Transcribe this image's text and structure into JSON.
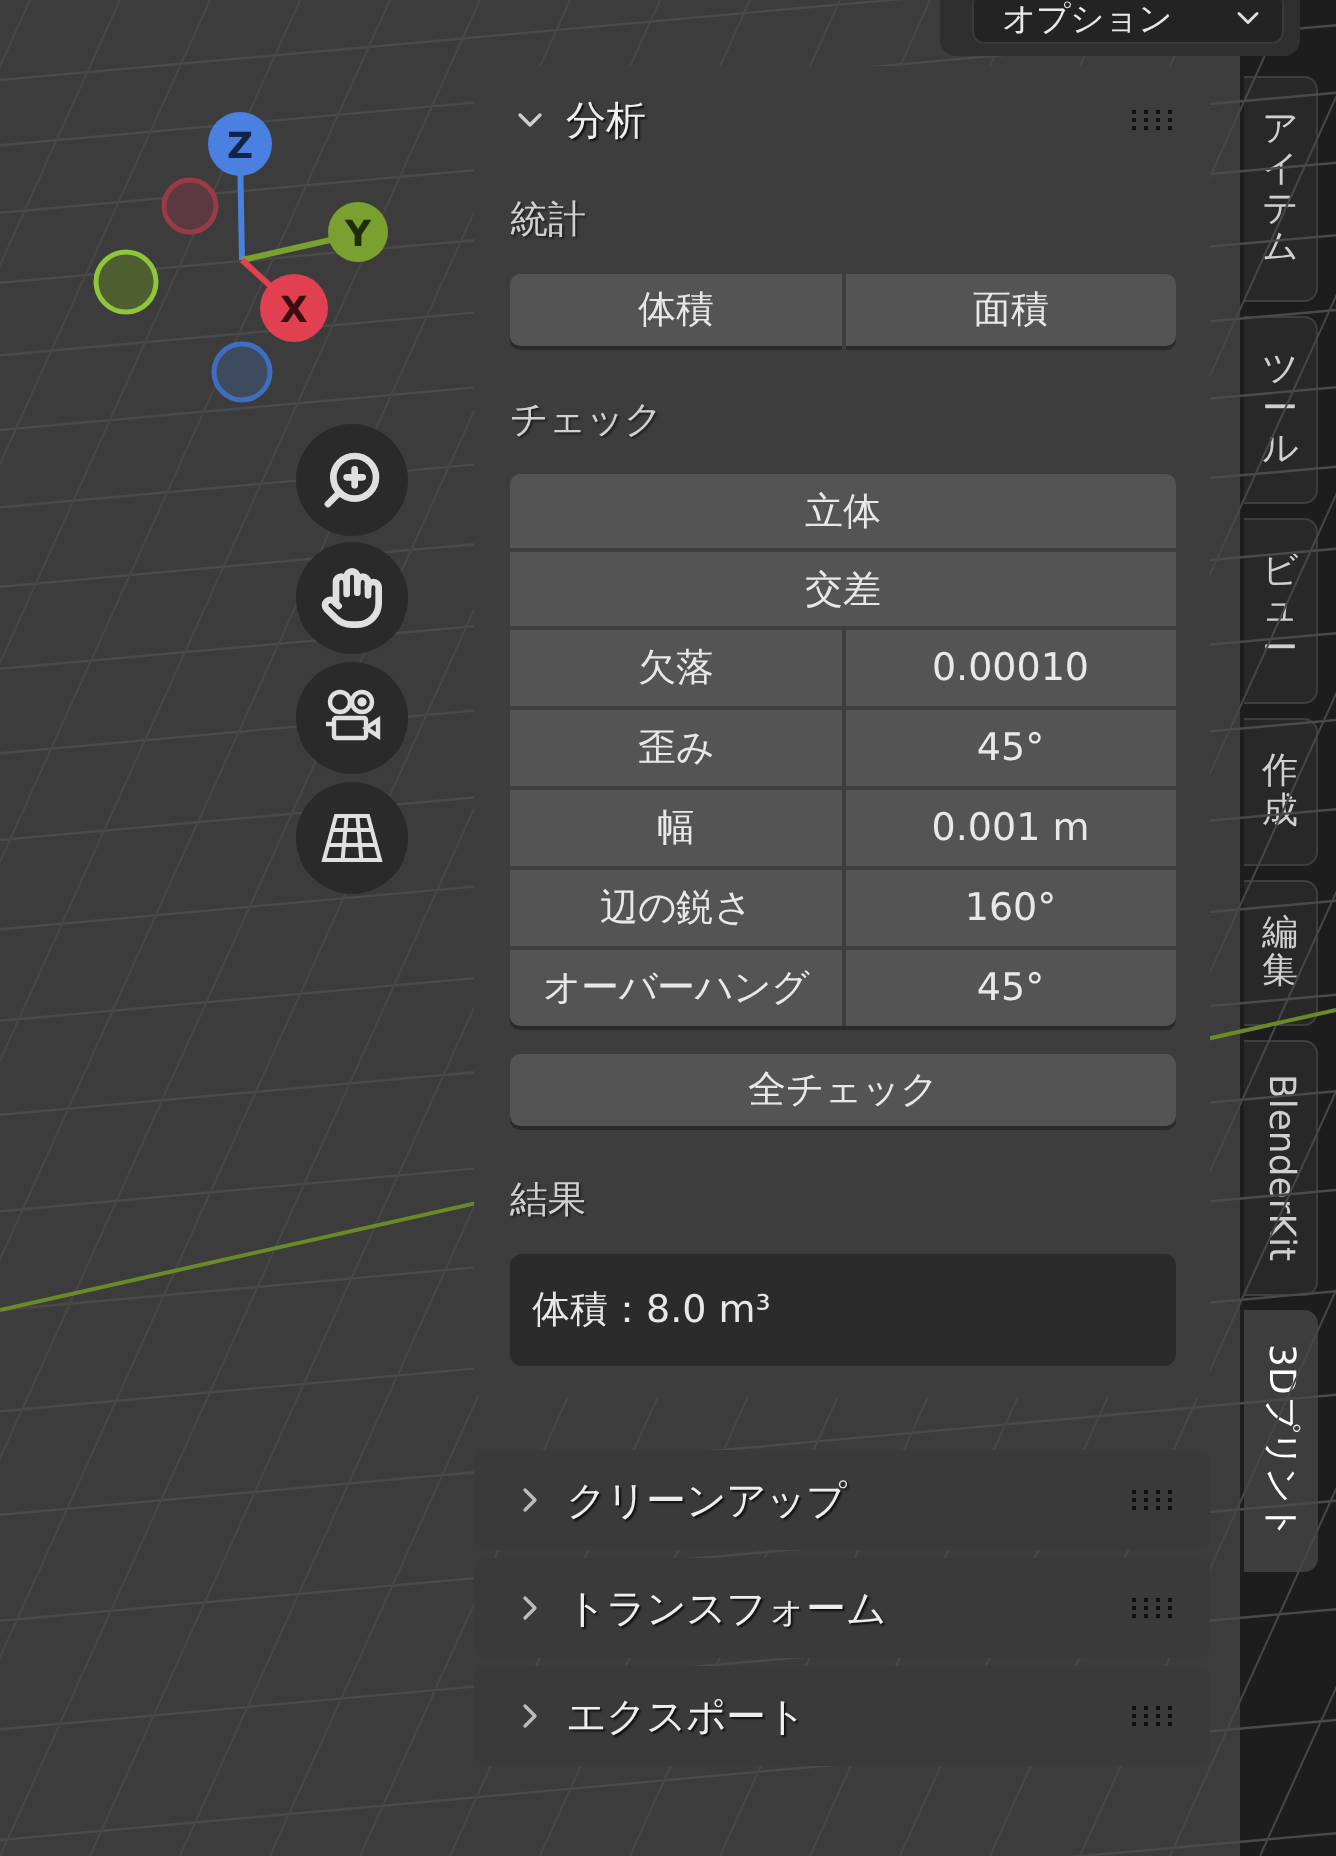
{
  "options_button": {
    "label": "オプション"
  },
  "gizmo": {
    "axes": [
      "X",
      "Y",
      "Z"
    ]
  },
  "analysis_panel": {
    "title": "分析",
    "expanded": true,
    "stats_label": "統計",
    "stats_buttons": [
      "体積",
      "面積"
    ],
    "check_label": "チェック",
    "check_items": [
      {
        "kind": "button",
        "label": "立体"
      },
      {
        "kind": "button",
        "label": "交差"
      },
      {
        "kind": "field",
        "label": "欠落",
        "value": "0.00010"
      },
      {
        "kind": "field",
        "label": "歪み",
        "value": "45°"
      },
      {
        "kind": "field",
        "label": "幅",
        "value": "0.001 m"
      },
      {
        "kind": "field",
        "label": "辺の鋭さ",
        "value": "160°"
      },
      {
        "kind": "field",
        "label": "オーバーハング",
        "value": "45°"
      }
    ],
    "check_all_button": "全チェック",
    "results_label": "結果",
    "result": "体積：8.0 m³"
  },
  "collapsed_panels": [
    {
      "title": "クリーンアップ",
      "expanded": false
    },
    {
      "title": "トランスフォーム",
      "expanded": false
    },
    {
      "title": "エクスポート",
      "expanded": false
    }
  ],
  "tabs": [
    {
      "label": "アイテム",
      "kind": "stacked",
      "selected": false
    },
    {
      "label": "ツール",
      "kind": "stacked",
      "selected": false
    },
    {
      "label": "ビュー",
      "kind": "stacked",
      "selected": false
    },
    {
      "label": "作成",
      "kind": "stacked",
      "selected": false
    },
    {
      "label": "編集",
      "kind": "stacked",
      "selected": false
    },
    {
      "label": "BlenderKit",
      "kind": "rotated",
      "selected": false
    },
    {
      "label": "3Dプリント",
      "kind": "rotated",
      "selected": true
    }
  ]
}
